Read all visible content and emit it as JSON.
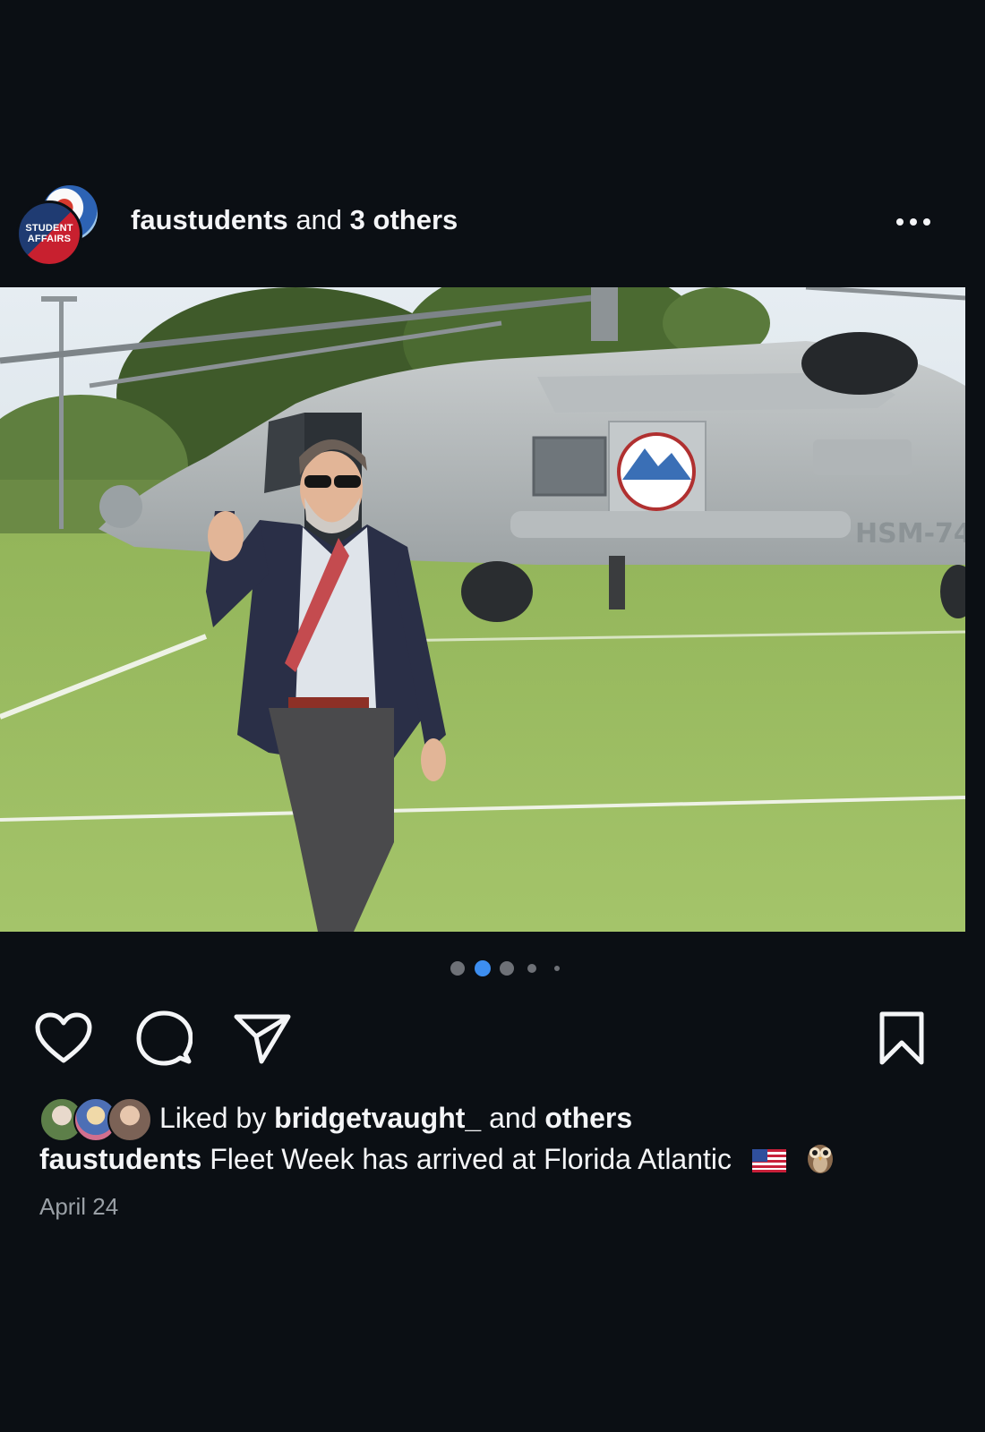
{
  "post": {
    "header": {
      "account": "faustudents",
      "connector": "and",
      "collaborators": "3 others",
      "avatar_text_line1": "STUDENT",
      "avatar_text_line2": "AFFAIRS"
    },
    "image": {
      "helicopter_marking": "HSM-74"
    },
    "carousel": {
      "count": 5,
      "active_index": 1
    },
    "actions": {
      "like_icon": "heart-icon",
      "comment_icon": "comment-icon",
      "share_icon": "paper-plane-icon",
      "save_icon": "bookmark-icon"
    },
    "likes": {
      "prefix": "Liked by",
      "user": "bridgetvaught_",
      "connector": "and",
      "others": "others"
    },
    "caption": {
      "account": "faustudents",
      "text": "Fleet Week has arrived at Florida Atlantic",
      "emojis": [
        "us-flag",
        "owl"
      ]
    },
    "date": "April 24"
  },
  "colors": {
    "background": "#0b0f14",
    "text": "#f4f5f7",
    "muted": "#9aa0a6",
    "active_dot": "#3d8ef0",
    "inactive_dot": "#6e7177"
  }
}
